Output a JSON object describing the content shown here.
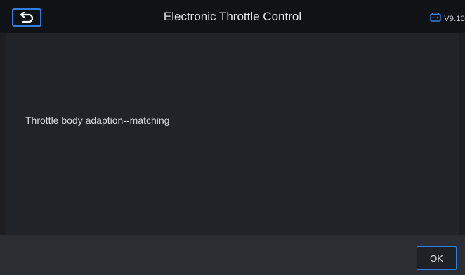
{
  "header": {
    "title": "Electronic Throttle Control",
    "back_icon": "back-arrow-icon",
    "battery_icon": "battery-icon",
    "version": "V9.10"
  },
  "main": {
    "message": "Throttle body adaption--matching"
  },
  "footer": {
    "ok_label": "OK"
  },
  "colors": {
    "accent": "#2f7fe0",
    "header_bg": "#101215",
    "content_bg": "#202327",
    "footer_bg": "#2a2d32"
  }
}
